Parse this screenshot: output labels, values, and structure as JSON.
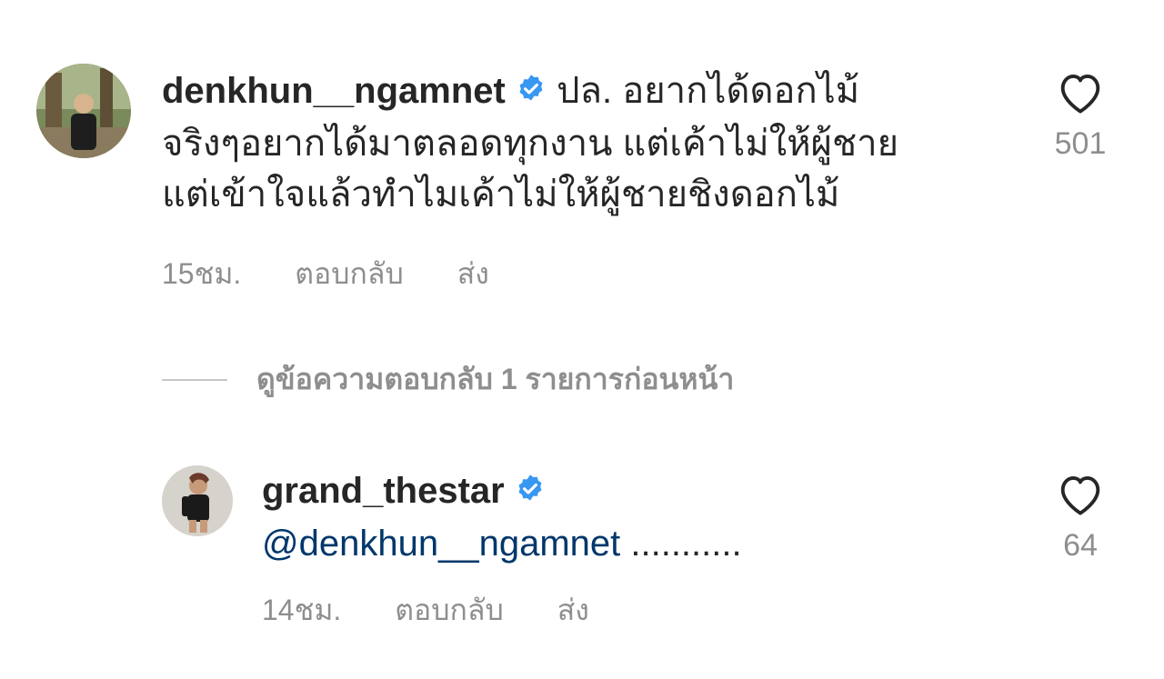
{
  "comment1": {
    "username": "denkhun__ngamnet",
    "text_line1": "ปล. อยากได้ดอกไม้",
    "text_line2": "จริงๆอยากได้มาตลอดทุกงาน แต่เค้าไม่ให้ผู้ชาย",
    "text_line3": "แต่เข้าใจแล้วทำไมเค้าไม่ให้ผู้ชายชิงดอกไม้",
    "time": "15ชม.",
    "reply_label": "ตอบกลับ",
    "send_label": "ส่ง",
    "likes": "501"
  },
  "view_replies": {
    "label": "ดูข้อความตอบกลับ 1 รายการก่อนหน้า"
  },
  "comment2": {
    "username": "grand_thestar",
    "mention": "@denkhun__ngamnet",
    "text": " ...........",
    "time": "14ชม.",
    "reply_label": "ตอบกลับ",
    "send_label": "ส่ง",
    "likes": "64"
  },
  "colors": {
    "verified": "#3897f0",
    "mention": "#00376b",
    "meta": "#8e8e8e"
  },
  "icons": [
    "verified-badge-icon",
    "heart-icon"
  ]
}
